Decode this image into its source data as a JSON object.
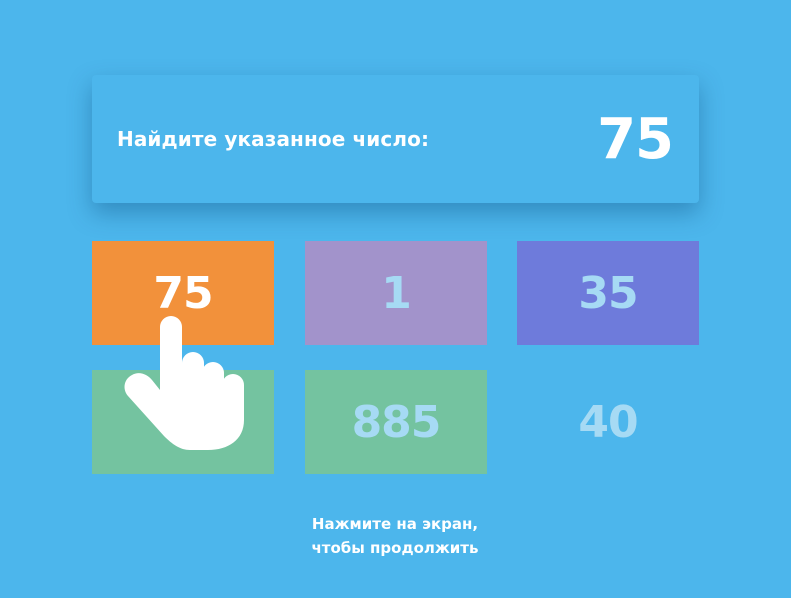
{
  "prompt": {
    "label": "Найдите указанное число:",
    "target": "75"
  },
  "tiles": [
    {
      "value": "75",
      "color": "#f2913b"
    },
    {
      "value": "1",
      "color": "#a293cb"
    },
    {
      "value": "35",
      "color": "#6e7bdb"
    },
    {
      "value": "",
      "color": "#74c3a0"
    },
    {
      "value": "885",
      "color": "#74c3a0"
    },
    {
      "value": "40",
      "color": "transparent"
    }
  ],
  "hint": {
    "line1": "Нажмите на экран,",
    "line2": "чтобы продолжить"
  },
  "icons": {
    "pointer": "pointing-hand-icon"
  },
  "colors": {
    "background": "#4cb6ec",
    "tile_text_muted": "#a6daf4",
    "text": "#ffffff"
  }
}
